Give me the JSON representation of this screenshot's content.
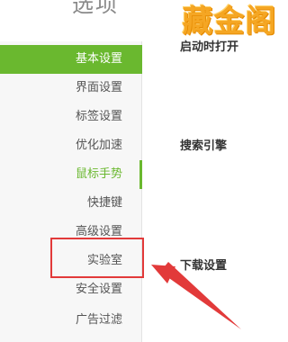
{
  "window": {
    "title": "选项"
  },
  "watermark": "藏金阁",
  "sidebar": {
    "items": [
      {
        "label": "基本设置"
      },
      {
        "label": "界面设置"
      },
      {
        "label": "标签设置"
      },
      {
        "label": "优化加速"
      },
      {
        "label": "鼠标手势"
      },
      {
        "label": "快捷键"
      },
      {
        "label": "高级设置"
      },
      {
        "label": "实验室"
      },
      {
        "label": "安全设置"
      },
      {
        "label": "广告过滤"
      }
    ],
    "selected": "基本设置",
    "hovered": "鼠标手势"
  },
  "content": {
    "sections": [
      {
        "title": "启动时打开"
      },
      {
        "title": "搜索引擎"
      },
      {
        "title": "下载设置"
      }
    ]
  },
  "annotation": {
    "highlighted_item": "实验室"
  },
  "colors": {
    "accent": "#6ab82f",
    "annotation": "#e23a3a",
    "watermark": "#f5a623"
  }
}
